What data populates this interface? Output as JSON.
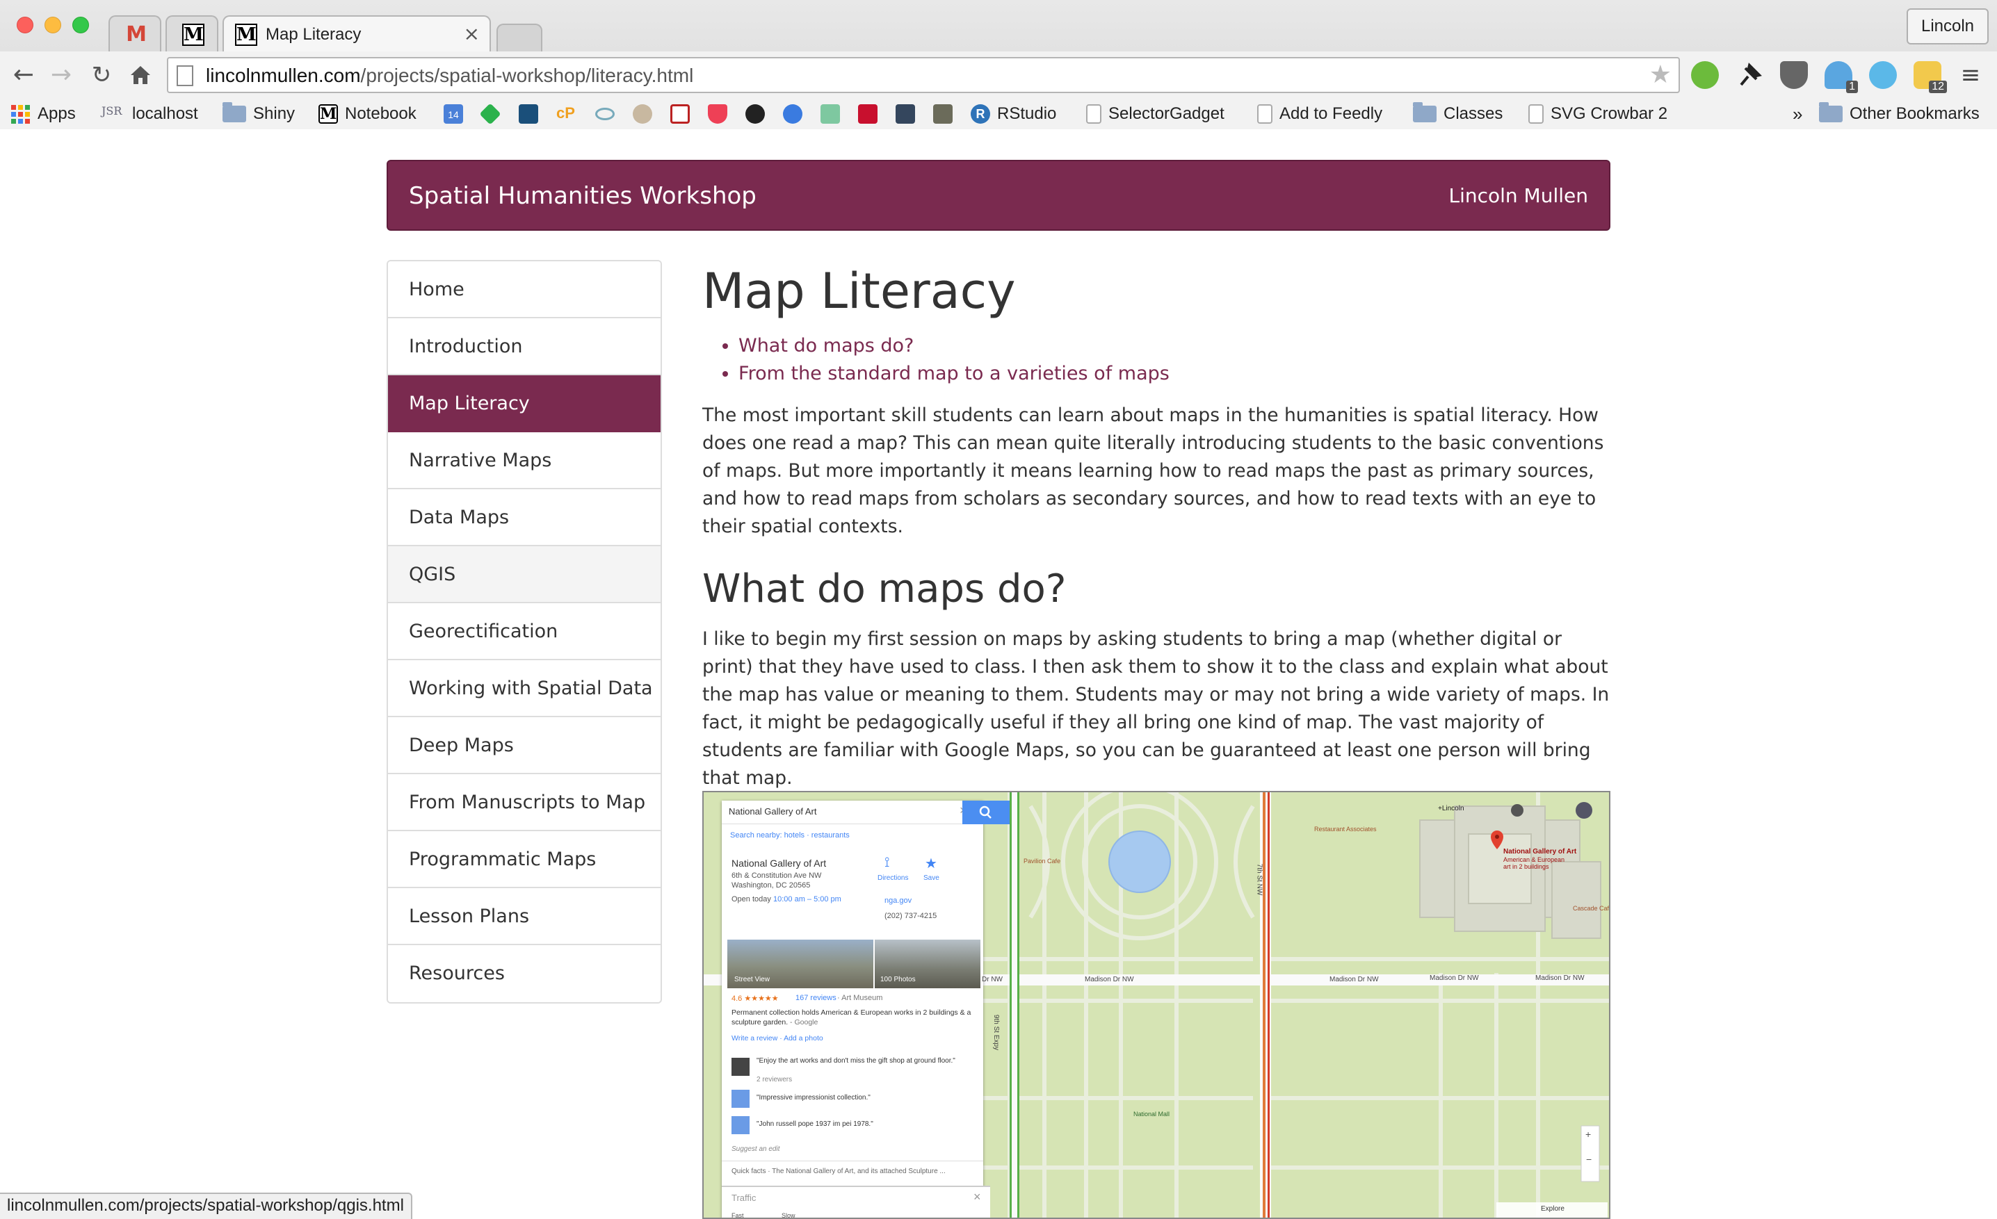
{
  "browser": {
    "tabs": [
      {
        "title": "",
        "icon": "gmail-icon"
      },
      {
        "title": "",
        "icon": "m-notebook-icon"
      },
      {
        "title": "Map Literacy",
        "icon": "m-notebook-icon"
      }
    ],
    "profile": "Lincoln",
    "url_domain": "lincolnmullen.com",
    "url_path": "/projects/spatial-workshop/literacy.html",
    "bookmarks": [
      {
        "label": "Apps",
        "icon": "apps-grid-icon"
      },
      {
        "label": "localhost",
        "icon": "jsr-icon"
      },
      {
        "label": "Shiny",
        "icon": "folder-icon"
      },
      {
        "label": "Notebook",
        "icon": "m-notebook-icon"
      },
      {
        "label": "RStudio",
        "icon": "r-icon"
      },
      {
        "label": "SelectorGadget",
        "icon": "page-icon"
      },
      {
        "label": "Add to Feedly",
        "icon": "page-icon"
      },
      {
        "label": "Classes",
        "icon": "folder-icon"
      },
      {
        "label": "SVG Crowbar 2",
        "icon": "page-icon"
      },
      {
        "label": "Other Bookmarks",
        "icon": "folder-icon"
      }
    ],
    "bookmarks_overflow": "»",
    "calendar_badge": "14",
    "cp_label": "cP",
    "ext_badges": [
      "1",
      "12"
    ],
    "status_url": "lincolnmullen.com/projects/spatial-workshop/qgis.html"
  },
  "site": {
    "brand": "Spatial Humanities Workshop",
    "author": "Lincoln Mullen",
    "accent": "#7a2a4f"
  },
  "nav": [
    {
      "label": "Home"
    },
    {
      "label": "Introduction"
    },
    {
      "label": "Map Literacy",
      "active": true
    },
    {
      "label": "Narrative Maps"
    },
    {
      "label": "Data Maps"
    },
    {
      "label": "QGIS",
      "hover": true
    },
    {
      "label": "Georectification"
    },
    {
      "label": "Working with Spatial Data"
    },
    {
      "label": "Deep Maps"
    },
    {
      "label": "From Manuscripts to Map"
    },
    {
      "label": "Programmatic Maps"
    },
    {
      "label": "Lesson Plans"
    },
    {
      "label": "Resources"
    }
  ],
  "content": {
    "title": "Map Literacy",
    "toc": [
      "What do maps do?",
      "From the standard map to a varieties of maps"
    ],
    "intro": "The most important skill students can learn about maps in the humanities is spatial literacy. How does one read a map? This can mean quite literally introducing students to the basic conventions of maps. But more importantly it means learning how to read maps the past as primary sources, and how to read maps from scholars as secondary sources, and how to read texts with an eye to their spatial contexts.",
    "section_heading": "What do maps do?",
    "section_text": "I like to begin my first session on maps by asking students to bring a map (whether digital or print) that they have used to class. I then ask them to show it to the class and explain what about the map has value or meaning to them. Students may or may not bring a wide variety of maps. In fact, it might be pedagogically useful if they all bring one kind of map. The vast majority of students are familiar with Google Maps, so you can be guaranteed at least one person will bring that map."
  },
  "map_image": {
    "search_value": "National Gallery of Art",
    "search_nearby": "Search nearby: hotels · restaurants",
    "place_name": "National Gallery of Art",
    "address_1": "6th & Constitution Ave NW",
    "address_2": "Washington, DC 20565",
    "hours_label": "Open today",
    "hours": "10:00 am – 5:00 pm",
    "directions": "Directions",
    "save": "Save",
    "website": "nga.gov",
    "phone": "(202) 737-4215",
    "street_view": "Street View",
    "photos": "100 Photos",
    "rating": "4.6 ★★★★★",
    "reviews": "167 reviews",
    "category": "· Art Museum",
    "summary": "Permanent collection holds American & European works in 2 buildings & a sculpture garden.",
    "summary_source": " - Google",
    "write_review": "Write a review · Add a photo",
    "review_1": "\"Enjoy the art works and don't miss the gift shop at ground floor.\"",
    "review_1_meta": "2 reviewers",
    "review_2": "\"Impressive impressionist collection.\"",
    "review_3": "\"John russell pope 1937 im pei 1978.\"",
    "suggest": "Suggest an edit",
    "quick_facts": "Quick facts · The National Gallery of Art, and its attached Sculpture ...",
    "traffic": "Traffic",
    "traffic_fast": "Fast",
    "traffic_slow": "Slow",
    "user": "+Lincoln",
    "pin_title": "National Gallery of Art",
    "pin_sub_1": "American & European",
    "pin_sub_2": "art in 2 buildings",
    "restaurant": "Restaurant Associates",
    "cafe_1": "Pavilion Cafe",
    "cafe_2": "Cascade Cafe",
    "street_1": "Madison Dr NW",
    "street_2": "Madison Dr NW",
    "street_3": "Madison Dr NW",
    "street_4": "Madison Dr NW",
    "street_5": "Dr NW",
    "expy": "9th St Expy",
    "expy2": "7th St NW",
    "mall": "National Mall",
    "explore": "Explore"
  }
}
